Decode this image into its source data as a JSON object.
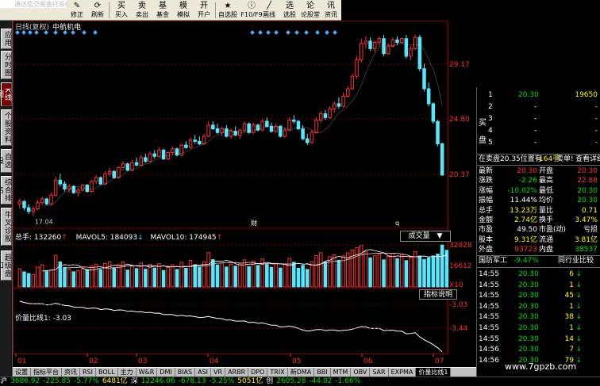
{
  "toolbar": {
    "faded_title": "通达信交易委托系统",
    "buttons": [
      {
        "label": "修正",
        "icon": "✎"
      },
      {
        "label": "刷新",
        "icon": "⟳"
      },
      {
        "label": "买入",
        "icon": "买"
      },
      {
        "label": "卖出",
        "icon": "卖"
      },
      {
        "label": "基金",
        "icon": "基"
      },
      {
        "label": "模拟",
        "icon": "模"
      },
      {
        "label": "开户",
        "icon": "开"
      },
      {
        "label": "自选股",
        "icon": "★"
      },
      {
        "label": "F10/F9",
        "icon": "ⓘ"
      },
      {
        "label": "画线",
        "icon": "╱"
      },
      {
        "label": "选股",
        "icon": "选"
      },
      {
        "label": "论股堂",
        "icon": "论"
      },
      {
        "label": "资讯",
        "icon": "讯"
      }
    ]
  },
  "left_tabs": [
    {
      "label": "应用",
      "active": false
    },
    {
      "label": "分时图",
      "active": false
    },
    {
      "label": "K线图",
      "active": true
    },
    {
      "label": "个股资料",
      "active": false
    },
    {
      "label": "自选股",
      "active": false
    },
    {
      "label": "综合排名",
      "active": false
    },
    {
      "label": "牛叉诊股",
      "active": false
    },
    {
      "label": "超级盘口",
      "active": false
    }
  ],
  "chart": {
    "period_label": "日线(复权)",
    "stock_name": "中航机电",
    "price_axis_labels": [
      "29.17",
      "24.80",
      "20.37"
    ],
    "low_marker": "17.04",
    "markers": [
      "财",
      "q"
    ],
    "volume_legend": {
      "total": "总手: 132260",
      "total_arrow": "↑",
      "ma5": "MAVOL5: 184093",
      "ma5_arrow": "↓",
      "ma10": "MAVOL10: 174945",
      "ma10_arrow": "↑"
    },
    "volume_axis_labels": [
      "32828",
      "16612",
      "X10"
    ],
    "volume_dropdown": "成交量",
    "indicator_legend": "价量比线1: -3.03",
    "indicator_axis_labels": [
      "-3.03",
      "-3.44"
    ],
    "indicator_button": "指标说明",
    "date_labels": [
      "01",
      "02",
      "03",
      "04",
      "05",
      "06",
      "07"
    ]
  },
  "chart_data": [
    {
      "type": "candlestick",
      "title": "日线(复权) 中航机电",
      "ylim": [
        16.5,
        31.5
      ],
      "axis_ticks": [
        29.17,
        24.8,
        20.37
      ],
      "bars": [
        {
          "o": 18.0,
          "h": 18.4,
          "l": 17.6,
          "c": 18.2
        },
        {
          "o": 18.2,
          "h": 18.3,
          "l": 17.5,
          "c": 17.7
        },
        {
          "o": 17.7,
          "h": 18.0,
          "l": 17.2,
          "c": 17.4
        },
        {
          "o": 17.4,
          "h": 17.8,
          "l": 17.04,
          "c": 17.6
        },
        {
          "o": 17.6,
          "h": 18.3,
          "l": 17.5,
          "c": 18.1
        },
        {
          "o": 18.1,
          "h": 18.6,
          "l": 17.9,
          "c": 18.4
        },
        {
          "o": 18.4,
          "h": 18.5,
          "l": 17.9,
          "c": 18.0
        },
        {
          "o": 18.0,
          "h": 18.9,
          "l": 17.9,
          "c": 18.7
        },
        {
          "o": 18.7,
          "h": 20.2,
          "l": 18.6,
          "c": 19.9
        },
        {
          "o": 19.9,
          "h": 20.4,
          "l": 19.4,
          "c": 19.6
        },
        {
          "o": 19.6,
          "h": 19.8,
          "l": 19.0,
          "c": 19.2
        },
        {
          "o": 19.2,
          "h": 19.6,
          "l": 18.9,
          "c": 19.4
        },
        {
          "o": 19.4,
          "h": 19.5,
          "l": 18.8,
          "c": 18.9
        },
        {
          "o": 18.9,
          "h": 19.3,
          "l": 18.6,
          "c": 19.1
        },
        {
          "o": 19.1,
          "h": 19.6,
          "l": 19.0,
          "c": 19.5
        },
        {
          "o": 19.5,
          "h": 19.6,
          "l": 18.9,
          "c": 19.0
        },
        {
          "o": 19.0,
          "h": 19.9,
          "l": 18.9,
          "c": 19.8
        },
        {
          "o": 19.8,
          "h": 20.3,
          "l": 19.6,
          "c": 20.1
        },
        {
          "o": 20.1,
          "h": 20.2,
          "l": 19.5,
          "c": 19.6
        },
        {
          "o": 19.6,
          "h": 20.6,
          "l": 19.5,
          "c": 20.4
        },
        {
          "o": 20.4,
          "h": 20.9,
          "l": 20.2,
          "c": 20.6
        },
        {
          "o": 20.6,
          "h": 20.7,
          "l": 20.0,
          "c": 20.1
        },
        {
          "o": 20.1,
          "h": 21.0,
          "l": 20.0,
          "c": 20.9
        },
        {
          "o": 20.9,
          "h": 21.4,
          "l": 20.7,
          "c": 21.2
        },
        {
          "o": 21.2,
          "h": 21.3,
          "l": 20.6,
          "c": 20.7
        },
        {
          "o": 20.7,
          "h": 21.5,
          "l": 20.6,
          "c": 21.3
        },
        {
          "o": 21.3,
          "h": 21.7,
          "l": 21.0,
          "c": 21.1
        },
        {
          "o": 21.1,
          "h": 21.9,
          "l": 21.0,
          "c": 21.7
        },
        {
          "o": 21.7,
          "h": 22.0,
          "l": 21.3,
          "c": 21.4
        },
        {
          "o": 21.4,
          "h": 22.2,
          "l": 21.3,
          "c": 22.0
        },
        {
          "o": 22.0,
          "h": 22.3,
          "l": 21.6,
          "c": 21.8
        },
        {
          "o": 21.8,
          "h": 22.5,
          "l": 21.7,
          "c": 22.3
        },
        {
          "o": 22.3,
          "h": 22.4,
          "l": 21.5,
          "c": 21.6
        },
        {
          "o": 21.6,
          "h": 22.2,
          "l": 21.5,
          "c": 22.1
        },
        {
          "o": 22.1,
          "h": 22.6,
          "l": 21.9,
          "c": 22.4
        },
        {
          "o": 22.4,
          "h": 22.5,
          "l": 21.8,
          "c": 21.9
        },
        {
          "o": 21.9,
          "h": 22.8,
          "l": 21.8,
          "c": 22.7
        },
        {
          "o": 22.7,
          "h": 23.0,
          "l": 22.4,
          "c": 22.5
        },
        {
          "o": 22.5,
          "h": 23.3,
          "l": 22.4,
          "c": 23.1
        },
        {
          "o": 23.1,
          "h": 23.5,
          "l": 22.8,
          "c": 23.0
        },
        {
          "o": 23.0,
          "h": 23.4,
          "l": 22.7,
          "c": 22.8
        },
        {
          "o": 22.8,
          "h": 23.6,
          "l": 22.7,
          "c": 23.4
        },
        {
          "o": 23.4,
          "h": 24.6,
          "l": 23.3,
          "c": 24.3
        },
        {
          "o": 24.3,
          "h": 24.6,
          "l": 23.9,
          "c": 24.0
        },
        {
          "o": 24.0,
          "h": 24.4,
          "l": 23.6,
          "c": 23.7
        },
        {
          "o": 23.7,
          "h": 24.2,
          "l": 23.4,
          "c": 24.0
        },
        {
          "o": 24.0,
          "h": 24.3,
          "l": 23.3,
          "c": 23.4
        },
        {
          "o": 23.4,
          "h": 24.0,
          "l": 23.2,
          "c": 23.8
        },
        {
          "o": 23.8,
          "h": 24.2,
          "l": 23.4,
          "c": 23.5
        },
        {
          "o": 23.5,
          "h": 24.0,
          "l": 23.2,
          "c": 23.9
        },
        {
          "o": 23.9,
          "h": 24.6,
          "l": 23.7,
          "c": 24.4
        },
        {
          "o": 24.4,
          "h": 24.5,
          "l": 23.6,
          "c": 23.7
        },
        {
          "o": 23.7,
          "h": 24.5,
          "l": 23.6,
          "c": 24.3
        },
        {
          "o": 24.3,
          "h": 24.4,
          "l": 23.8,
          "c": 23.9
        },
        {
          "o": 23.9,
          "h": 24.8,
          "l": 23.8,
          "c": 24.6
        },
        {
          "o": 24.6,
          "h": 24.9,
          "l": 24.1,
          "c": 24.2
        },
        {
          "o": 24.2,
          "h": 24.5,
          "l": 23.7,
          "c": 23.8
        },
        {
          "o": 23.8,
          "h": 24.4,
          "l": 23.7,
          "c": 24.2
        },
        {
          "o": 24.2,
          "h": 24.3,
          "l": 23.3,
          "c": 23.4
        },
        {
          "o": 23.4,
          "h": 24.1,
          "l": 23.3,
          "c": 23.9
        },
        {
          "o": 23.9,
          "h": 24.9,
          "l": 23.8,
          "c": 24.7
        },
        {
          "o": 24.7,
          "h": 25.1,
          "l": 24.4,
          "c": 24.6
        },
        {
          "o": 24.6,
          "h": 24.7,
          "l": 23.9,
          "c": 24.0
        },
        {
          "o": 24.0,
          "h": 24.3,
          "l": 23.1,
          "c": 23.2
        },
        {
          "o": 23.2,
          "h": 23.6,
          "l": 22.7,
          "c": 22.9
        },
        {
          "o": 22.9,
          "h": 23.9,
          "l": 22.8,
          "c": 23.7
        },
        {
          "o": 23.7,
          "h": 24.9,
          "l": 23.6,
          "c": 24.7
        },
        {
          "o": 24.7,
          "h": 25.4,
          "l": 24.5,
          "c": 25.2
        },
        {
          "o": 25.2,
          "h": 25.5,
          "l": 24.7,
          "c": 24.9
        },
        {
          "o": 24.9,
          "h": 25.8,
          "l": 24.8,
          "c": 25.6
        },
        {
          "o": 25.6,
          "h": 26.2,
          "l": 25.3,
          "c": 26.0
        },
        {
          "o": 26.0,
          "h": 26.5,
          "l": 25.6,
          "c": 25.8
        },
        {
          "o": 25.8,
          "h": 26.9,
          "l": 25.7,
          "c": 26.6
        },
        {
          "o": 26.6,
          "h": 27.4,
          "l": 26.5,
          "c": 27.2
        },
        {
          "o": 27.2,
          "h": 28.4,
          "l": 27.1,
          "c": 28.2
        },
        {
          "o": 28.2,
          "h": 29.8,
          "l": 28.0,
          "c": 29.5
        },
        {
          "o": 29.5,
          "h": 31.2,
          "l": 29.3,
          "c": 30.8
        },
        {
          "o": 30.8,
          "h": 31.4,
          "l": 30.4,
          "c": 31.0
        },
        {
          "o": 31.0,
          "h": 31.3,
          "l": 30.2,
          "c": 30.4
        },
        {
          "o": 30.4,
          "h": 31.0,
          "l": 30.1,
          "c": 30.9
        },
        {
          "o": 30.9,
          "h": 31.4,
          "l": 30.6,
          "c": 31.2
        },
        {
          "o": 31.2,
          "h": 31.5,
          "l": 29.8,
          "c": 30.0
        },
        {
          "o": 30.0,
          "h": 30.8,
          "l": 29.9,
          "c": 30.6
        },
        {
          "o": 30.6,
          "h": 31.3,
          "l": 30.5,
          "c": 31.1
        },
        {
          "o": 31.1,
          "h": 31.4,
          "l": 30.7,
          "c": 30.9
        },
        {
          "o": 30.9,
          "h": 31.3,
          "l": 30.8,
          "c": 31.2
        },
        {
          "o": 31.2,
          "h": 31.5,
          "l": 29.6,
          "c": 29.8
        },
        {
          "o": 29.8,
          "h": 30.6,
          "l": 29.5,
          "c": 30.4
        },
        {
          "o": 30.4,
          "h": 31.5,
          "l": 30.3,
          "c": 31.3
        },
        {
          "o": 31.3,
          "h": 31.5,
          "l": 28.6,
          "c": 28.8
        },
        {
          "o": 28.8,
          "h": 29.2,
          "l": 27.0,
          "c": 27.2
        },
        {
          "o": 27.2,
          "h": 27.7,
          "l": 25.8,
          "c": 26.0
        },
        {
          "o": 26.0,
          "h": 26.1,
          "l": 24.4,
          "c": 24.6
        },
        {
          "o": 24.6,
          "h": 24.7,
          "l": 22.6,
          "c": 22.8
        },
        {
          "o": 22.8,
          "h": 22.9,
          "l": 20.3,
          "c": 20.3
        }
      ]
    },
    {
      "type": "bar",
      "title": "成交量",
      "series_labels": [
        "总手",
        "MAVOL5",
        "MAVOL10"
      ],
      "ylim": [
        0,
        36000
      ],
      "axis_ticks": [
        32828,
        16612
      ],
      "values": [
        14200,
        11800,
        10500,
        9800,
        15500,
        17200,
        12300,
        13500,
        24800,
        19600,
        15200,
        13800,
        11900,
        12600,
        14100,
        13400,
        16200,
        17800,
        13600,
        18400,
        19600,
        14700,
        17300,
        19500,
        13200,
        16800,
        14400,
        18800,
        13900,
        17600,
        14800,
        18200,
        12900,
        15800,
        17300,
        13700,
        19200,
        14600,
        20800,
        17400,
        15500,
        19800,
        26800,
        21400,
        17200,
        18900,
        15600,
        17800,
        16300,
        18100,
        21200,
        15900,
        20300,
        16800,
        21900,
        17600,
        15200,
        18400,
        14800,
        17700,
        22300,
        19300,
        14600,
        16900,
        13700,
        19800,
        24600,
        26800,
        19500,
        23700,
        25100,
        20900,
        24300,
        26700,
        28900,
        30800,
        32400,
        27600,
        22800,
        24600,
        25900,
        21200,
        23800,
        26300,
        22100,
        25400,
        20600,
        23100,
        27700,
        24200,
        21500,
        22700,
        24300,
        25800,
        32828,
        28700
      ]
    }
  ],
  "quote": {
    "bid_label_1": "买",
    "bid_label_2": "盘",
    "levels": [
      {
        "idx": "1",
        "price": "20.30",
        "vol": "19650"
      },
      {
        "idx": "2",
        "price": "-",
        "vol": "-"
      },
      {
        "idx": "3",
        "price": "-",
        "vol": "-"
      },
      {
        "idx": "4",
        "price": "-",
        "vol": "-"
      },
      {
        "idx": "5",
        "price": "-",
        "vol": "-"
      }
    ],
    "sell_banner": "在卖盘20.35位置有",
    "sell_banner_qty": "164手",
    "sell_banner_tag": "卖单!",
    "sell_banner_link": "查看详细",
    "stats": [
      {
        "l1": "最新",
        "v1": "20.30",
        "c1": "c-red",
        "l2": "开盘",
        "v2": "20.30",
        "c2": "c-red"
      },
      {
        "l1": "涨跌",
        "v1": "-2.26",
        "c1": "c-grn",
        "l2": "最高",
        "v2": "22.88",
        "c2": "c-red"
      },
      {
        "l1": "涨幅",
        "v1": "-10.02%",
        "c1": "c-grn",
        "l2": "最低",
        "v2": "20.30",
        "c2": "c-grn"
      },
      {
        "l1": "振幅",
        "v1": "11.44%",
        "c1": "c-wht",
        "l2": "均价",
        "v2": "20.30",
        "c2": "c-grn"
      },
      {
        "l1": "总手",
        "v1": "13.23万",
        "c1": "c-yel",
        "l2": "量比",
        "v2": "0.71",
        "c2": "c-yel"
      },
      {
        "l1": "金额",
        "v1": "2.74亿",
        "c1": "c-yel",
        "l2": "换手",
        "v2": "3.47%",
        "c2": "c-yel"
      },
      {
        "l1": "市盈",
        "v1": "49.50",
        "c1": "c-wht",
        "l2": "市盈(动)",
        "v2": "亏损",
        "c2": "c-wht"
      },
      {
        "l1": "股本",
        "v1": "9.31亿",
        "c1": "c-yel",
        "l2": "流通",
        "v2": "3.81亿",
        "c2": "c-yel"
      },
      {
        "l1": "外盘",
        "v1": "93723",
        "c1": "c-red",
        "l2": "内盘",
        "v2": "38537",
        "c2": "c-grn"
      }
    ],
    "sector_name": "国防军工",
    "sector_change": "-9.47%",
    "sector_link": "同行业比较",
    "ticks": [
      {
        "t": "14:55",
        "p": "20.30",
        "v": "6",
        "d": "↓"
      },
      {
        "t": "14:55",
        "p": "20.30",
        "v": "1",
        "d": "↓"
      },
      {
        "t": "14:55",
        "p": "20.30",
        "v": "45",
        "d": "↓"
      },
      {
        "t": "14:55",
        "p": "20.30",
        "v": "1",
        "d": "↓"
      },
      {
        "t": "14:55",
        "p": "20.30",
        "v": "38",
        "d": "↓"
      },
      {
        "t": "14:55",
        "p": "20.30",
        "v": "1",
        "d": "↓"
      },
      {
        "t": "14:55",
        "p": "20.30",
        "v": "14",
        "d": "↓"
      },
      {
        "t": "14:56",
        "p": "20.30",
        "v": "7",
        "d": "↓"
      },
      {
        "t": "14:56",
        "p": "20.30",
        "v": "79",
        "d": "↓"
      }
    ]
  },
  "bottom_tabs": [
    {
      "label": "设置",
      "active": false
    },
    {
      "label": "指标平台",
      "active": false
    },
    {
      "label": "资讯",
      "active": false
    },
    {
      "label": "RSI",
      "active": false
    },
    {
      "label": "BOLL",
      "active": false
    },
    {
      "label": "主力",
      "active": false
    },
    {
      "label": "W&R",
      "active": false
    },
    {
      "label": "DMI",
      "active": false
    },
    {
      "label": "BIAS",
      "active": false
    },
    {
      "label": "ASI",
      "active": false
    },
    {
      "label": "VR",
      "active": false
    },
    {
      "label": "ARBR",
      "active": false
    },
    {
      "label": "DPO",
      "active": false
    },
    {
      "label": "TRIX",
      "active": false
    },
    {
      "label": "新DMA",
      "active": false
    },
    {
      "label": "BBI",
      "active": false
    },
    {
      "label": "MTM",
      "active": false
    },
    {
      "label": "OBV",
      "active": false
    },
    {
      "label": "SAR",
      "active": false
    },
    {
      "label": "EXPMA",
      "active": false
    },
    {
      "label": "价量比线1",
      "active": true
    }
  ],
  "status_bar": [
    {
      "text": "沪",
      "cls": "c-wht"
    },
    {
      "text": "3686.92",
      "cls": "c-grn"
    },
    {
      "text": "-225.85",
      "cls": "c-grn"
    },
    {
      "text": "-5.77%",
      "cls": "c-grn"
    },
    {
      "text": "6481亿",
      "cls": "c-yel"
    },
    {
      "text": "深",
      "cls": "c-wht"
    },
    {
      "text": "12246.06",
      "cls": "c-grn"
    },
    {
      "text": "-678.13",
      "cls": "c-grn"
    },
    {
      "text": "-5.25%",
      "cls": "c-grn"
    },
    {
      "text": "5051亿",
      "cls": "c-yel"
    },
    {
      "text": "创",
      "cls": "c-wht"
    },
    {
      "text": "2605.28",
      "cls": "c-grn"
    },
    {
      "text": "-44.02",
      "cls": "c-grn"
    },
    {
      "text": "-1.66%",
      "cls": "c-grn"
    }
  ],
  "watermark": "www.7gpzb.com",
  "colors": {
    "up": "#ff3030",
    "down": "#54e8ff",
    "bg": "#000000",
    "grid": "#7a0000"
  }
}
